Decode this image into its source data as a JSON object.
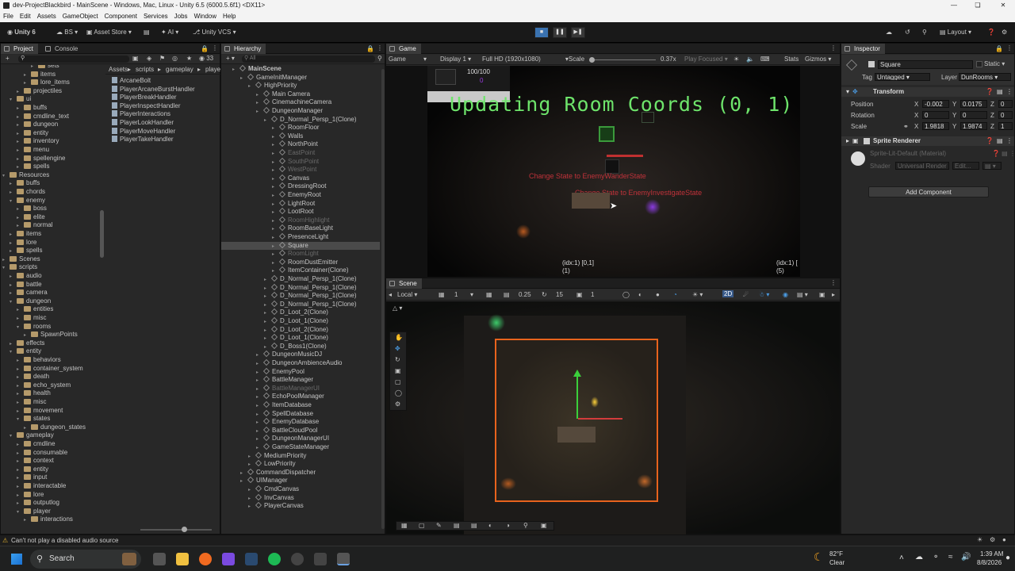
{
  "window": {
    "title": "dev-ProjectBlackbird - MainScene - Windows, Mac, Linux - Unity 6.5 (6000.5.6f1) <DX11>"
  },
  "menu": [
    "File",
    "Edit",
    "Assets",
    "GameObject",
    "Component",
    "Services",
    "Jobs",
    "Window",
    "Help"
  ],
  "toolbar": {
    "unity": "Unity 6",
    "bs": "BS",
    "asset_store": "Asset Store",
    "ai": "AI",
    "vcs": "Unity VCS",
    "layout": "Layout"
  },
  "project": {
    "tabs": [
      "Project",
      "Console"
    ],
    "badge": "33",
    "breadcrumb": [
      "Assets",
      "scripts",
      "gameplay",
      "playe"
    ],
    "tree": [
      {
        "l": "sets",
        "d": 5
      },
      {
        "l": "items",
        "d": 4
      },
      {
        "l": "lore_items",
        "d": 4
      },
      {
        "l": "projectiles",
        "d": 3
      },
      {
        "l": "ui",
        "d": 2,
        "o": true
      },
      {
        "l": "buffs",
        "d": 3
      },
      {
        "l": "cmdline_text",
        "d": 3
      },
      {
        "l": "dungeon",
        "d": 3
      },
      {
        "l": "entity",
        "d": 3
      },
      {
        "l": "inventory",
        "d": 3
      },
      {
        "l": "menu",
        "d": 3
      },
      {
        "l": "spellengine",
        "d": 3
      },
      {
        "l": "spells",
        "d": 3
      },
      {
        "l": "Resources",
        "d": 1,
        "o": true
      },
      {
        "l": "buffs",
        "d": 2
      },
      {
        "l": "chords",
        "d": 2
      },
      {
        "l": "enemy",
        "d": 2,
        "o": true
      },
      {
        "l": "boss",
        "d": 3
      },
      {
        "l": "elite",
        "d": 3
      },
      {
        "l": "normal",
        "d": 3
      },
      {
        "l": "items",
        "d": 2
      },
      {
        "l": "lore",
        "d": 2
      },
      {
        "l": "spells",
        "d": 2
      },
      {
        "l": "Scenes",
        "d": 1
      },
      {
        "l": "scripts",
        "d": 1,
        "o": true
      },
      {
        "l": "audio",
        "d": 2
      },
      {
        "l": "battle",
        "d": 2
      },
      {
        "l": "camera",
        "d": 2
      },
      {
        "l": "dungeon",
        "d": 2,
        "o": true
      },
      {
        "l": "entities",
        "d": 3
      },
      {
        "l": "misc",
        "d": 3
      },
      {
        "l": "rooms",
        "d": 3,
        "o": true
      },
      {
        "l": "SpawnPoints",
        "d": 4
      },
      {
        "l": "effects",
        "d": 2
      },
      {
        "l": "entity",
        "d": 2,
        "o": true
      },
      {
        "l": "behaviors",
        "d": 3
      },
      {
        "l": "container_system",
        "d": 3
      },
      {
        "l": "death",
        "d": 3
      },
      {
        "l": "echo_system",
        "d": 3
      },
      {
        "l": "health",
        "d": 3
      },
      {
        "l": "misc",
        "d": 3
      },
      {
        "l": "movement",
        "d": 3
      },
      {
        "l": "states",
        "d": 3,
        "o": true
      },
      {
        "l": "dungeon_states",
        "d": 4
      },
      {
        "l": "gameplay",
        "d": 2,
        "o": true
      },
      {
        "l": "cmdline",
        "d": 3
      },
      {
        "l": "consumable",
        "d": 3
      },
      {
        "l": "context",
        "d": 3
      },
      {
        "l": "entity",
        "d": 3
      },
      {
        "l": "input",
        "d": 3
      },
      {
        "l": "interactable",
        "d": 3
      },
      {
        "l": "lore",
        "d": 3
      },
      {
        "l": "outputlog",
        "d": 3
      },
      {
        "l": "player",
        "d": 3,
        "o": true
      },
      {
        "l": "interactions",
        "d": 4
      }
    ],
    "files": [
      "ArcaneBolt",
      "PlayerArcaneBurstHandler",
      "PlayerBreakHandler",
      "PlayerInspectHandler",
      "PlayerInteractions",
      "PlayerLookHandler",
      "PlayerMoveHandler",
      "PlayerTakeHandler"
    ]
  },
  "hierarchy": {
    "tab": "Hierarchy",
    "search_placeholder": "All",
    "rows": [
      {
        "l": "MainScene",
        "d": 0,
        "b": true
      },
      {
        "l": "GameInitManager",
        "d": 1
      },
      {
        "l": "HighPriority",
        "d": 2
      },
      {
        "l": "Main Camera",
        "d": 3
      },
      {
        "l": "CinemachineCamera",
        "d": 3
      },
      {
        "l": "DungeonManager",
        "d": 3
      },
      {
        "l": "D_Normal_Persp_1(Clone)",
        "d": 4
      },
      {
        "l": "RoomFloor",
        "d": 5
      },
      {
        "l": "Walls",
        "d": 5
      },
      {
        "l": "NorthPoint",
        "d": 5
      },
      {
        "l": "EastPoint",
        "d": 5,
        "dim": true
      },
      {
        "l": "SouthPoint",
        "d": 5,
        "dim": true
      },
      {
        "l": "WestPoint",
        "d": 5,
        "dim": true
      },
      {
        "l": "Canvas",
        "d": 5
      },
      {
        "l": "DressingRoot",
        "d": 5
      },
      {
        "l": "EnemyRoot",
        "d": 5
      },
      {
        "l": "LightRoot",
        "d": 5
      },
      {
        "l": "LootRoot",
        "d": 5
      },
      {
        "l": "RoomHighlight",
        "d": 5,
        "dim": true
      },
      {
        "l": "RoomBaseLight",
        "d": 5
      },
      {
        "l": "PresenceLight",
        "d": 5
      },
      {
        "l": "Square",
        "d": 5,
        "sel": true
      },
      {
        "l": "RoomLight",
        "d": 5,
        "dim": true
      },
      {
        "l": "RoomDustEmitter",
        "d": 5
      },
      {
        "l": "ItemContainer(Clone)",
        "d": 5
      },
      {
        "l": "D_Normal_Persp_1(Clone)",
        "d": 4
      },
      {
        "l": "D_Normal_Persp_1(Clone)",
        "d": 4
      },
      {
        "l": "D_Normal_Persp_1(Clone)",
        "d": 4
      },
      {
        "l": "D_Normal_Persp_1(Clone)",
        "d": 4
      },
      {
        "l": "D_Loot_2(Clone)",
        "d": 4
      },
      {
        "l": "D_Loot_1(Clone)",
        "d": 4
      },
      {
        "l": "D_Loot_2(Clone)",
        "d": 4
      },
      {
        "l": "D_Loot_1(Clone)",
        "d": 4
      },
      {
        "l": "D_Boss1(Clone)",
        "d": 4
      },
      {
        "l": "DungeonMusicDJ",
        "d": 3
      },
      {
        "l": "DungeonAmbienceAudio",
        "d": 3
      },
      {
        "l": "EnemyPool",
        "d": 3
      },
      {
        "l": "BattleManager",
        "d": 3
      },
      {
        "l": "BattleManagerUI",
        "d": 3,
        "dim": true
      },
      {
        "l": "EchoPoolManager",
        "d": 3
      },
      {
        "l": "ItemDatabase",
        "d": 3
      },
      {
        "l": "SpellDatabase",
        "d": 3
      },
      {
        "l": "EnemyDatabase",
        "d": 3
      },
      {
        "l": "BattleCloudPool",
        "d": 3
      },
      {
        "l": "DungeonManagerUI",
        "d": 3
      },
      {
        "l": "GameStateManager",
        "d": 3
      },
      {
        "l": "MediumPriority",
        "d": 2
      },
      {
        "l": "LowPriority",
        "d": 2
      },
      {
        "l": "CommandDispatcher",
        "d": 1
      },
      {
        "l": "UIManager",
        "d": 1
      },
      {
        "l": "CmdCanvas",
        "d": 2
      },
      {
        "l": "InvCanvas",
        "d": 2
      },
      {
        "l": "PlayerCanvas",
        "d": 2
      }
    ]
  },
  "game": {
    "tab": "Game",
    "bar": {
      "mode": "Game",
      "display": "Display 1",
      "res": "Full HD (1920x1080)",
      "scale_label": "Scale",
      "scale": "0.37x",
      "play_focused": "Play Focused",
      "stats": "Stats",
      "gizmos": "Gizmos"
    },
    "hp": "100/100",
    "mana": "0",
    "banner": "Updating Room Coords (0, 1)",
    "msg1": "Change State to EnemyWanderState",
    "msg2": "Change State to EnemyInvestigateState",
    "coord1": "(idx:1) [0,1]",
    "coord1b": "(1)",
    "coord2": "(idx:1) [",
    "coord2b": "(5)"
  },
  "scene": {
    "tab": "Scene",
    "local": "Local",
    "snap": "1",
    "angle": "0.25",
    "rot": "15",
    "scale": "1",
    "mode2d": "2D"
  },
  "inspector": {
    "tab": "Inspector",
    "name": "Square",
    "static": "Static",
    "tag_label": "Tag",
    "tag": "Untagged",
    "layer_label": "Layer",
    "layer": "DunRooms",
    "transform": "Transform",
    "position_label": "Position",
    "px": "-0.002",
    "py": "0.0175",
    "pz": "0",
    "rotation_label": "Rotation",
    "rx": "0",
    "ry": "0",
    "rz": "0",
    "scale_label": "Scale",
    "sx": "1.9818",
    "sy": "1.9874",
    "sz": "1",
    "sprite_renderer": "Sprite Renderer",
    "material": "Sprite-Lit-Default (Material)",
    "shader_label": "Shader",
    "shader": "Universal Render P▸",
    "edit": "Edit...",
    "add_component": "Add Component"
  },
  "status": {
    "warning": "Can't not play a disabled audio source"
  },
  "taskbar": {
    "search": "Search",
    "temp": "82°F",
    "weather": "Clear",
    "time": "1:39 AM",
    "date": "8/8/2026"
  }
}
